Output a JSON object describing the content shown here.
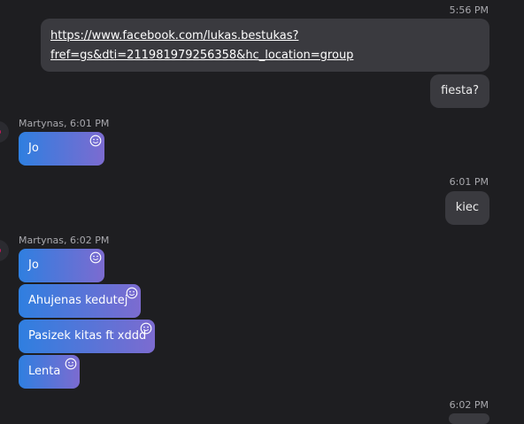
{
  "colors": {
    "background": "#1e1e21",
    "outgoing_bubble": "#3a3a3f",
    "incoming_gradient_start": "#2f7fe0",
    "incoming_gradient_end": "#7c6bd0",
    "meta_text": "#a8a8ad"
  },
  "conversation": {
    "group1": {
      "time": "5:56 PM",
      "link_line1": "https://www.facebook.com/lukas.bestukas?",
      "link_line2": "fref=gs&dti=211981979256358&hc_location=group",
      "message2": "fiesta?"
    },
    "group2": {
      "sender": "Martynas, 6:01 PM",
      "message1": "Jo"
    },
    "group3": {
      "time": "6:01 PM",
      "message1": "kiec"
    },
    "group4": {
      "sender": "Martynas, 6:02 PM",
      "messages": [
        "Jo",
        "Ahujenas kedutej",
        "Pasizek kitas ft xddd",
        "Lenta"
      ]
    },
    "group5": {
      "time": "6:02 PM"
    }
  },
  "icons": {
    "reaction": "smiley-face-icon",
    "avatar": "avatar"
  }
}
